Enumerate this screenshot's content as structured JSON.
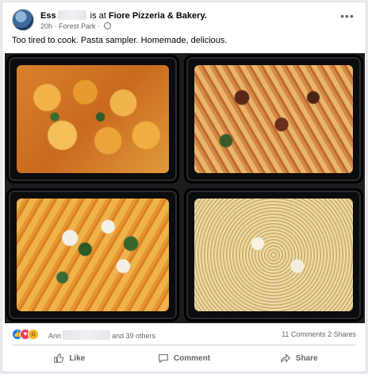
{
  "post": {
    "author_visible": "Ess",
    "checkin_text": "is at",
    "place": "Fiore Pizzeria & Bakery.",
    "time": "20h",
    "location": "Forest Park",
    "body": "Too tired to cook. Pasta sampler. Homemade, delicious."
  },
  "reactions": {
    "icons": [
      "like-icon",
      "love-icon",
      "wow-icon"
    ],
    "names_prefix": "Ann",
    "names_suffix": "and 39 others",
    "comments": "11 Comments",
    "shares": "2 Shares"
  },
  "actions": {
    "like": "Like",
    "comment": "Comment",
    "share": "Share"
  },
  "colors": {
    "accent": "#1877f2",
    "love": "#f33e58",
    "wow": "#f7b125",
    "secondary_text": "#65676b"
  }
}
